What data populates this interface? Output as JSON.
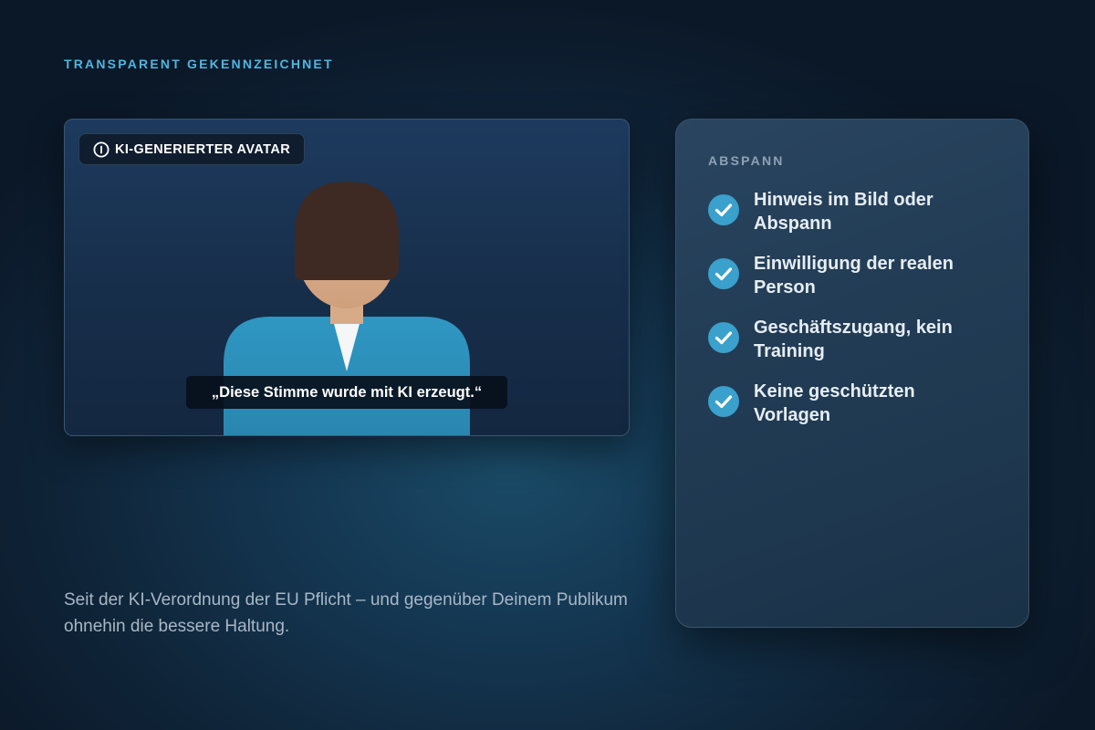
{
  "eyebrow": "TRANSPARENT GEKENNZEICHNET",
  "video": {
    "badge_label": "KI-GENERIERTER AVATAR",
    "badge_icon": "info-icon",
    "caption": "„Diese Stimme wurde mit KI erzeugt.“"
  },
  "description": "Seit der KI-Verordnung der EU Pflicht – und gegenüber Deinem Publikum ohnehin die bessere Haltung.",
  "panel": {
    "title": "ABSPANN",
    "items": [
      {
        "label": "Hinweis im Bild oder Abspann",
        "icon": "check-icon"
      },
      {
        "label": "Einwilligung der realen Person",
        "icon": "check-icon"
      },
      {
        "label": "Geschäftszugang, kein Training",
        "icon": "check-icon"
      },
      {
        "label": "Keine geschützten Vorlagen",
        "icon": "check-icon"
      }
    ]
  },
  "colors": {
    "accent": "#4fb6df",
    "check_fill": "#3aa0cc",
    "shirt": "#2a8fba",
    "hair": "#3e2a22",
    "skin": "#d9ad8a"
  }
}
